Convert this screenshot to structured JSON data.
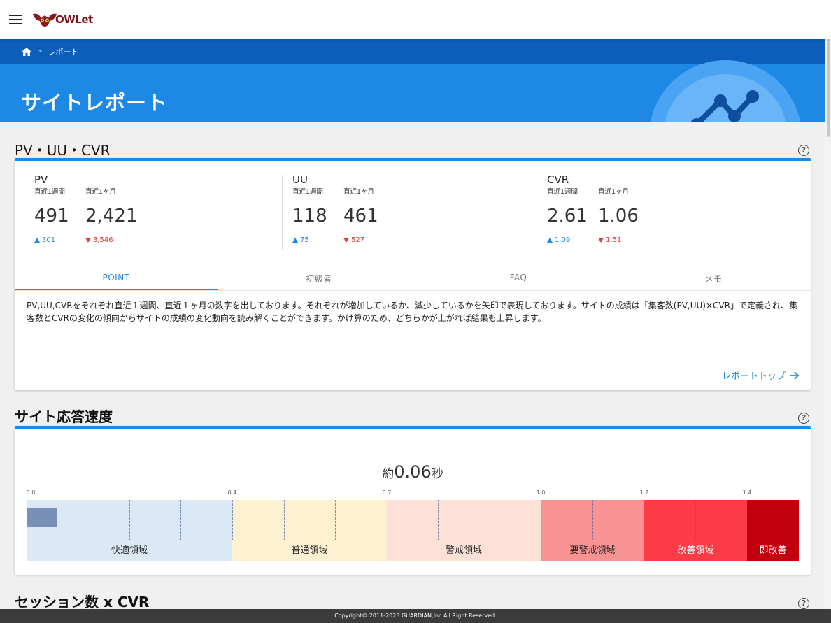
{
  "app": {
    "logo_text": "OWLet"
  },
  "breadcrumb": {
    "current": "レポート"
  },
  "header": {
    "title": "サイトレポート"
  },
  "section_pv": {
    "title": "PV・UU・CVR",
    "metrics": [
      {
        "name": "PV",
        "week_label": "直近1週間",
        "month_label": "直近1ヶ月",
        "week_value": "491",
        "month_value": "2,421",
        "week_delta": "301",
        "month_delta": "3,546"
      },
      {
        "name": "UU",
        "week_label": "直近1週間",
        "month_label": "直近1ヶ月",
        "week_value": "118",
        "month_value": "461",
        "week_delta": "75",
        "month_delta": "527"
      },
      {
        "name": "CVR",
        "week_label": "直近1週間",
        "month_label": "直近1ヶ月",
        "week_value": "2.61",
        "month_value": "1.06",
        "week_delta": "1.09",
        "month_delta": "1.51"
      }
    ],
    "tabs": [
      "POINT",
      "初級者",
      "FAQ",
      "メモ"
    ],
    "point_text": "PV,UU,CVRをそれぞれ直近１週間、直近１ヶ月の数字を出しております。それぞれが増加しているか、減少しているかを矢印で表現しております。サイトの成績は「集客数(PV,UU)×CVR」で定義され、集客数とCVRの変化の傾向からサイトの成績の変化動向を読み解くことができます。かけ算のため、どちらかが上がれば結果も上昇します。",
    "report_top_link": "レポートトップ"
  },
  "section_speed": {
    "title": "サイト応答速度",
    "prefix": "約",
    "value": "0.06",
    "suffix": "秒",
    "response_seconds": 0.06,
    "ticks": [
      "0.0",
      "0.4",
      "0.7",
      "1.0",
      "1.2",
      "1.4"
    ],
    "zones": [
      "快適領域",
      "普通領域",
      "警戒領域",
      "要警戒領域",
      "改善領域",
      "即改善"
    ],
    "zone_colors": [
      "#dbe8f5",
      "#fdf1d1",
      "#fde1d7",
      "#f99393",
      "#fb3b45",
      "#c2000d"
    ]
  },
  "section_session": {
    "title": "セッション数 x CVR"
  },
  "footer": {
    "copyright": "Copyright© 2011-2023 GUARDIAN,Inc All Right Reserved."
  }
}
